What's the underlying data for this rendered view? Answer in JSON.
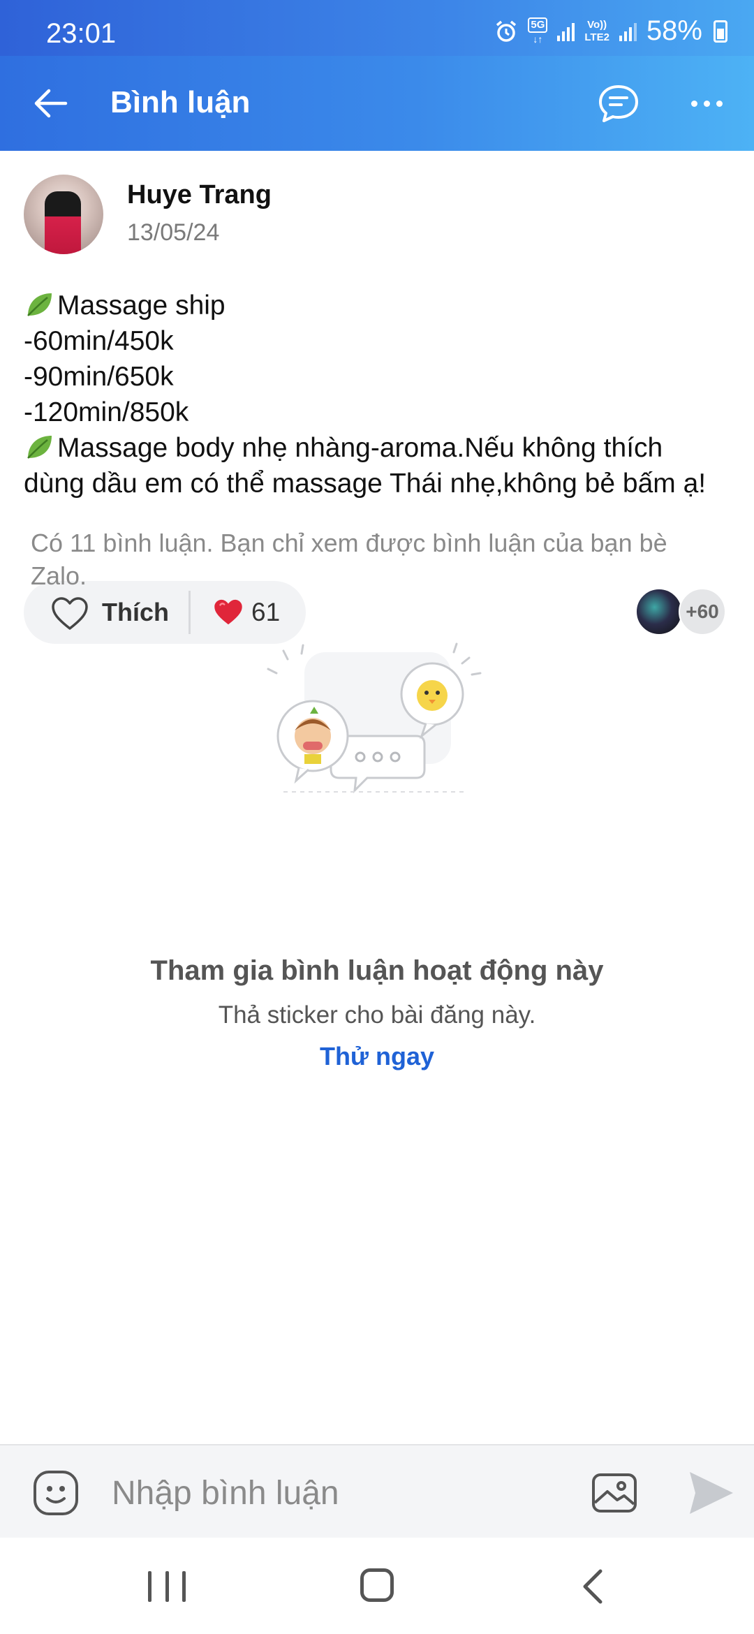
{
  "status_bar": {
    "time": "23:01",
    "network_5g": "5G",
    "volte_top": "Vo))",
    "volte_bottom": "LTE2",
    "battery": "58%"
  },
  "header": {
    "title": "Bình luận"
  },
  "post": {
    "author": "Huye Trang",
    "date": "13/05/24",
    "lines": [
      "Massage ship",
      "-60min/450k",
      "-90min/650k",
      "-120min/850k",
      "Massage body nhẹ nhàng-aroma.Nếu không thích dùng dầu em có thể massage Thái nhẹ,không bẻ bấm ạ!"
    ]
  },
  "actions": {
    "like_label": "Thích",
    "reaction_count": "61",
    "reactors_more": "+60"
  },
  "comments": {
    "notice": "Có 11 bình luận. Bạn chỉ xem được bình luận của bạn bè Zalo."
  },
  "cta": {
    "title": "Tham gia bình luận hoạt động này",
    "subtitle": "Thả sticker cho bài đăng này.",
    "link": "Thử ngay"
  },
  "comment_bar": {
    "placeholder": "Nhập bình luận"
  },
  "colors": {
    "accent": "#1f62d6",
    "header_start": "#2f6fe0",
    "header_end": "#4db2f5",
    "heart_red": "#e0263a"
  }
}
